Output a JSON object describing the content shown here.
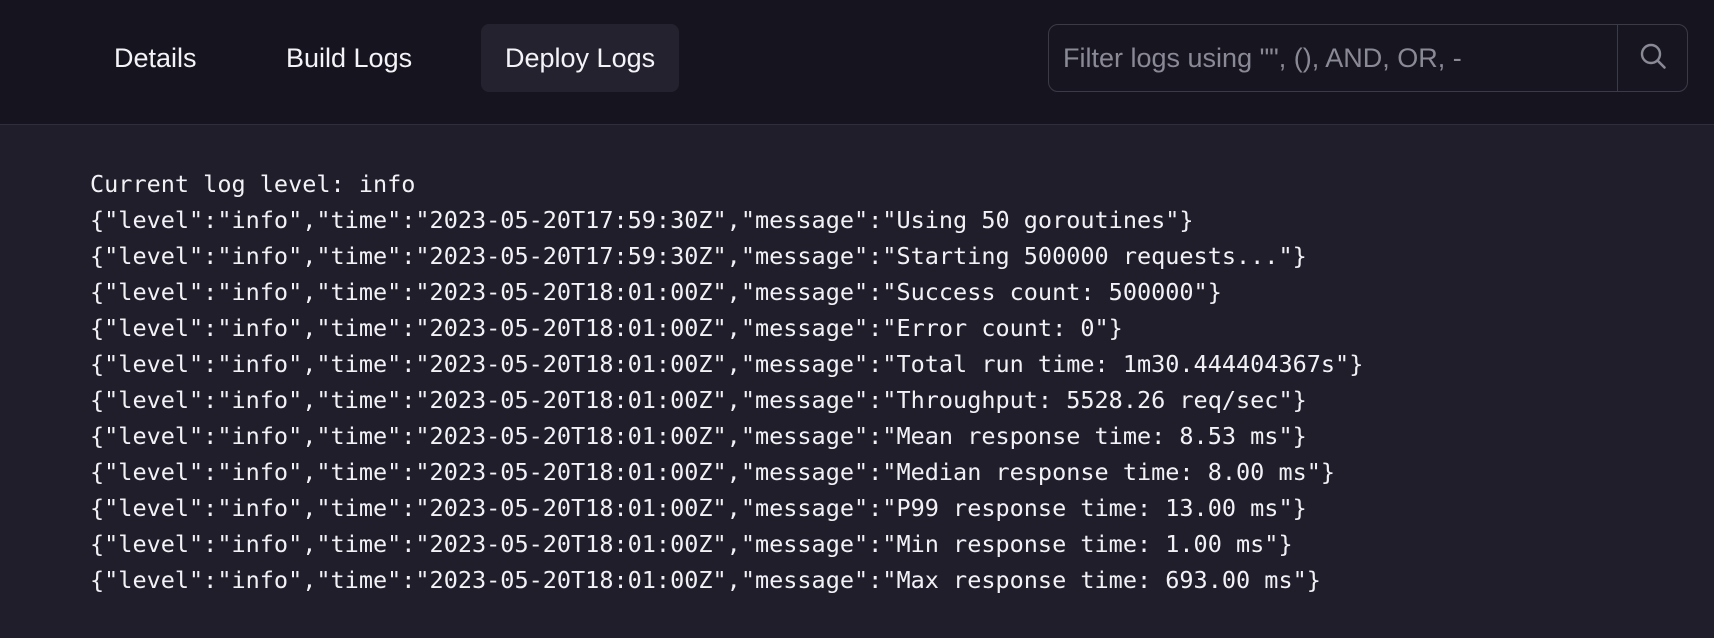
{
  "tabs": [
    {
      "label": "Details",
      "active": false
    },
    {
      "label": "Build Logs",
      "active": false
    },
    {
      "label": "Deploy Logs",
      "active": true
    }
  ],
  "filter": {
    "placeholder": "Filter logs using \"\", (), AND, OR, -",
    "value": "",
    "button_icon": "search-icon"
  },
  "logs": [
    "Current log level: info",
    "{\"level\":\"info\",\"time\":\"2023-05-20T17:59:30Z\",\"message\":\"Using 50 goroutines\"}",
    "{\"level\":\"info\",\"time\":\"2023-05-20T17:59:30Z\",\"message\":\"Starting 500000 requests...\"}",
    "{\"level\":\"info\",\"time\":\"2023-05-20T18:01:00Z\",\"message\":\"Success count: 500000\"}",
    "{\"level\":\"info\",\"time\":\"2023-05-20T18:01:00Z\",\"message\":\"Error count: 0\"}",
    "{\"level\":\"info\",\"time\":\"2023-05-20T18:01:00Z\",\"message\":\"Total run time: 1m30.444404367s\"}",
    "{\"level\":\"info\",\"time\":\"2023-05-20T18:01:00Z\",\"message\":\"Throughput: 5528.26 req/sec\"}",
    "{\"level\":\"info\",\"time\":\"2023-05-20T18:01:00Z\",\"message\":\"Mean response time: 8.53 ms\"}",
    "{\"level\":\"info\",\"time\":\"2023-05-20T18:01:00Z\",\"message\":\"Median response time: 8.00 ms\"}",
    "{\"level\":\"info\",\"time\":\"2023-05-20T18:01:00Z\",\"message\":\"P99 response time: 13.00 ms\"}",
    "{\"level\":\"info\",\"time\":\"2023-05-20T18:01:00Z\",\"message\":\"Min response time: 1.00 ms\"}",
    "{\"level\":\"info\",\"time\":\"2023-05-20T18:01:00Z\",\"message\":\"Max response time: 693.00 ms\"}"
  ],
  "colors": {
    "header_bg": "#16151f",
    "body_bg": "#1f1e2a",
    "active_tab_bg": "#23222e",
    "text": "#f2f2f6",
    "placeholder": "#8a8996"
  }
}
